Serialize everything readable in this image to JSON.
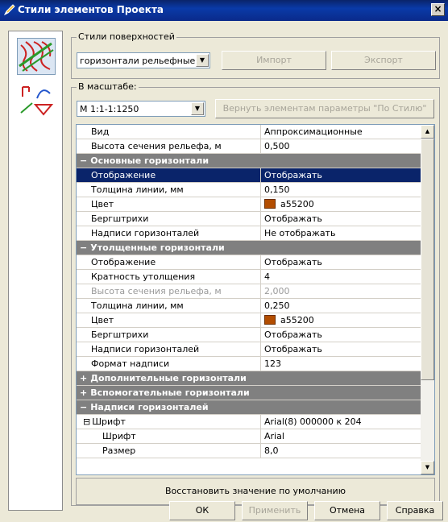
{
  "window": {
    "title": "Стили элементов Проекта",
    "close_label": "×"
  },
  "surface_group": {
    "label": "Стили поверхностей",
    "selected": "горизонтали рельефные",
    "import_label": "Импорт",
    "export_label": "Экспорт"
  },
  "scale_group": {
    "label": "В масштабе:",
    "selected": "М 1:1-1:1250",
    "reset_label": "Вернуть элементам параметры \"По Стилю\""
  },
  "rows": [
    {
      "name": "Вид",
      "value": "Аппроксимационные"
    },
    {
      "name": "Высота сечения рельефа, м",
      "value": "0,500"
    },
    {
      "name": "Основные горизонтали",
      "category": true,
      "expander": "−"
    },
    {
      "name": "Отображение",
      "value": "Отображать",
      "selected": true
    },
    {
      "name": "Толщина линии, мм",
      "value": "0,150"
    },
    {
      "name": "Цвет",
      "value": "a55200",
      "color": "#b34d00"
    },
    {
      "name": "Бергштрихи",
      "value": "Отображать"
    },
    {
      "name": "Надписи горизонталей",
      "value": "Не отображать"
    },
    {
      "name": "Утолщенные горизонтали",
      "category": true,
      "expander": "−"
    },
    {
      "name": "Отображение",
      "value": "Отображать"
    },
    {
      "name": "Кратность утолщения",
      "value": "4"
    },
    {
      "name": "Высота сечения рельефа, м",
      "value": "2,000",
      "disabled": true
    },
    {
      "name": "Толщина линии, мм",
      "value": "0,250"
    },
    {
      "name": "Цвет",
      "value": "a55200",
      "color": "#b34d00"
    },
    {
      "name": "Бергштрихи",
      "value": "Отображать"
    },
    {
      "name": "Надписи горизонталей",
      "value": "Отображать"
    },
    {
      "name": "Формат надписи",
      "value": "123"
    },
    {
      "name": "Дополнительные горизонтали",
      "category": true,
      "expander": "+"
    },
    {
      "name": "Вспомогательные горизонтали",
      "category": true,
      "expander": "+"
    },
    {
      "name": "Надписи горизонталей",
      "category": true,
      "expander": "−"
    },
    {
      "name": "Шрифт",
      "value": "Arial(8) 000000 к 204",
      "tree": "⊟"
    },
    {
      "name": "Шрифт",
      "value": "Arial",
      "indent": 2
    },
    {
      "name": "Размер",
      "value": "8,0",
      "indent": 2
    }
  ],
  "restore_label": "Восстановить значение по умолчанию",
  "buttons": {
    "ok": "ОК",
    "apply": "Применить",
    "cancel": "Отмена",
    "help": "Справка"
  },
  "icons": [
    "pencil-icon",
    "contour-lines-icon",
    "style-tools-icon",
    "scroll-up-icon",
    "scroll-down-icon",
    "combo-arrow-icon"
  ]
}
